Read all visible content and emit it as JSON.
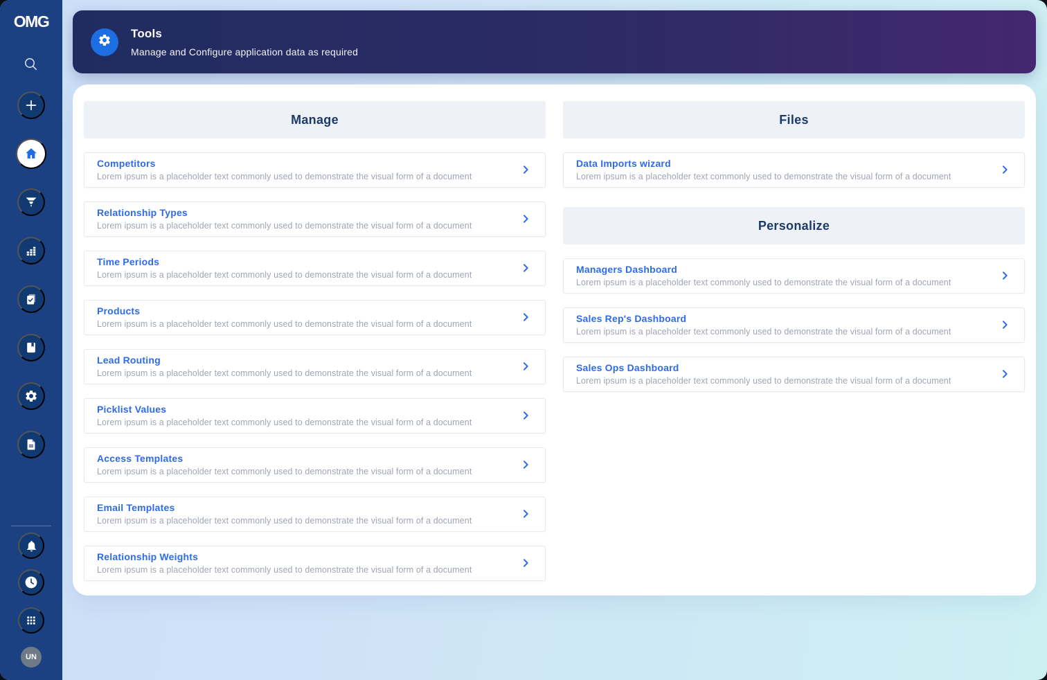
{
  "window": {
    "logo": "OMG",
    "avatar_initials": "UN"
  },
  "sidebar": {
    "icons": [
      "search-icon",
      "plus-icon",
      "home-icon",
      "filter-icon",
      "bar-chart-icon",
      "document-check-icon",
      "book-icon",
      "gear-icon",
      "file-icon",
      "bell-icon",
      "clock-icon",
      "apps-grid-icon"
    ],
    "active_item": "home"
  },
  "banner": {
    "icon": "gear-icon",
    "title": "Tools",
    "subtitle": "Manage and Configure application data as required"
  },
  "manage": {
    "title": "Manage",
    "items": [
      {
        "title": "Competitors",
        "description": "Lorem ipsum is a placeholder text commonly used to demonstrate the visual form of a document"
      },
      {
        "title": "Relationship Types",
        "description": "Lorem ipsum is a placeholder text commonly used to demonstrate the visual form of a document"
      },
      {
        "title": "Time Periods",
        "description": "Lorem ipsum is a placeholder text commonly used to demonstrate the visual form of a document"
      },
      {
        "title": "Products",
        "description": "Lorem ipsum is a placeholder text commonly used to demonstrate the visual form of a document"
      },
      {
        "title": "Lead Routing",
        "description": "Lorem ipsum is a placeholder text commonly used to demonstrate the visual form of a document"
      },
      {
        "title": "Picklist Values",
        "description": "Lorem ipsum is a placeholder text commonly used to demonstrate the visual form of a document"
      },
      {
        "title": "Access Templates",
        "description": "Lorem ipsum is a placeholder text commonly used to demonstrate the visual form of a document"
      },
      {
        "title": "Email Templates",
        "description": "Lorem ipsum is a placeholder text commonly used to demonstrate the visual form of a document"
      },
      {
        "title": "Relationship Weights",
        "description": "Lorem ipsum is a placeholder text commonly used to demonstrate the visual form of a document"
      }
    ]
  },
  "files": {
    "title": "Files",
    "items": [
      {
        "title": "Data Imports wizard",
        "description": "Lorem ipsum is a placeholder text commonly used to demonstrate the visual form of a document"
      }
    ]
  },
  "personalize": {
    "title": "Personalize",
    "items": [
      {
        "title": "Managers Dashboard",
        "description": "Lorem ipsum is a placeholder text commonly used to demonstrate the visual form of a document"
      },
      {
        "title": "Sales Rep's Dashboard",
        "description": "Lorem ipsum is a placeholder text commonly used to demonstrate the visual form of a document"
      },
      {
        "title": "Sales Ops Dashboard",
        "description": "Lorem ipsum is a placeholder text commonly used to demonstrate the visual form of a document"
      }
    ]
  },
  "colors": {
    "sidebar_bg": "#1b4183",
    "sidebar_circle": "#123a72",
    "accent_blue": "#2e6be6",
    "badge_blue": "#1e6ee3",
    "banner_gradient_from": "#202c5f",
    "banner_gradient_to": "#44276f",
    "page_gradient_from": "#cddef8",
    "page_gradient_to": "#cdf0f3",
    "section_header_bg": "#eef1f6",
    "heading_navy": "#1c3a6b",
    "description_gray": "#9fa6b2",
    "avatar_gray": "#6e7a87"
  }
}
